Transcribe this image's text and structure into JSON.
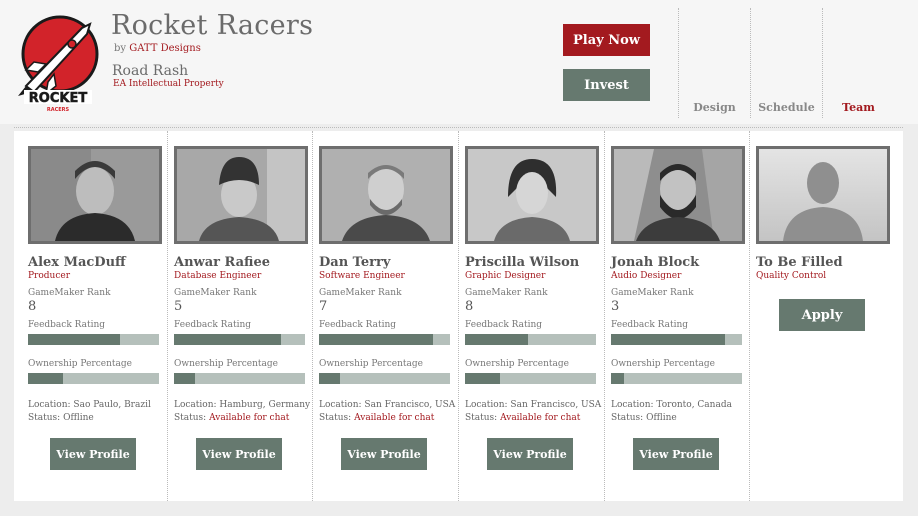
{
  "header": {
    "app_title": "Rocket Racers",
    "by_prefix": "by",
    "by_company": "GATT Designs",
    "project_title": "Road Rash",
    "project_ip": "EA Intellectual Property",
    "logo_text": "ROCKET",
    "logo_subtext": "RACERS"
  },
  "buttons": {
    "play": "Play Now",
    "invest": "Invest",
    "apply": "Apply",
    "view_profile": "View Profile"
  },
  "nav": {
    "tabs": [
      {
        "label": "Design",
        "active": false
      },
      {
        "label": "Schedule",
        "active": false
      },
      {
        "label": "Team",
        "active": true
      }
    ]
  },
  "labels": {
    "rank": "GameMaker Rank",
    "feedback": "Feedback Rating",
    "ownership": "Ownership Percentage",
    "location_prefix": "Location:",
    "status_prefix": "Status:"
  },
  "members": [
    {
      "name": "Alex MacDuff",
      "role": "Producer",
      "rank": "8",
      "feedback": 0.7,
      "ownership": 0.27,
      "location": "Sao Paulo, Brazil",
      "status": "Offline",
      "status_highlight": false
    },
    {
      "name": "Anwar Rafiee",
      "role": "Database Engineer",
      "rank": "5",
      "feedback": 0.82,
      "ownership": 0.16,
      "location": "Hamburg, Germany",
      "status": "Available for chat",
      "status_highlight": true
    },
    {
      "name": "Dan Terry",
      "role": "Software Engineer",
      "rank": "7",
      "feedback": 0.87,
      "ownership": 0.16,
      "location": "San Francisco, USA",
      "status": "Available for chat",
      "status_highlight": true
    },
    {
      "name": "Priscilla Wilson",
      "role": "Graphic Designer",
      "rank": "8",
      "feedback": 0.48,
      "ownership": 0.27,
      "location": "San Francisco, USA",
      "status": "Available for chat",
      "status_highlight": true
    },
    {
      "name": "Jonah Block",
      "role": "Audio Designer",
      "rank": "3",
      "feedback": 0.87,
      "ownership": 0.1,
      "location": "Toronto, Canada",
      "status": "Offline",
      "status_highlight": false
    }
  ],
  "open_position": {
    "name": "To Be Filled",
    "role": "Quality Control"
  },
  "colors": {
    "accent_red": "#a31a1f",
    "accent_green": "#66796f",
    "bar_bg": "#b5c0bb"
  }
}
